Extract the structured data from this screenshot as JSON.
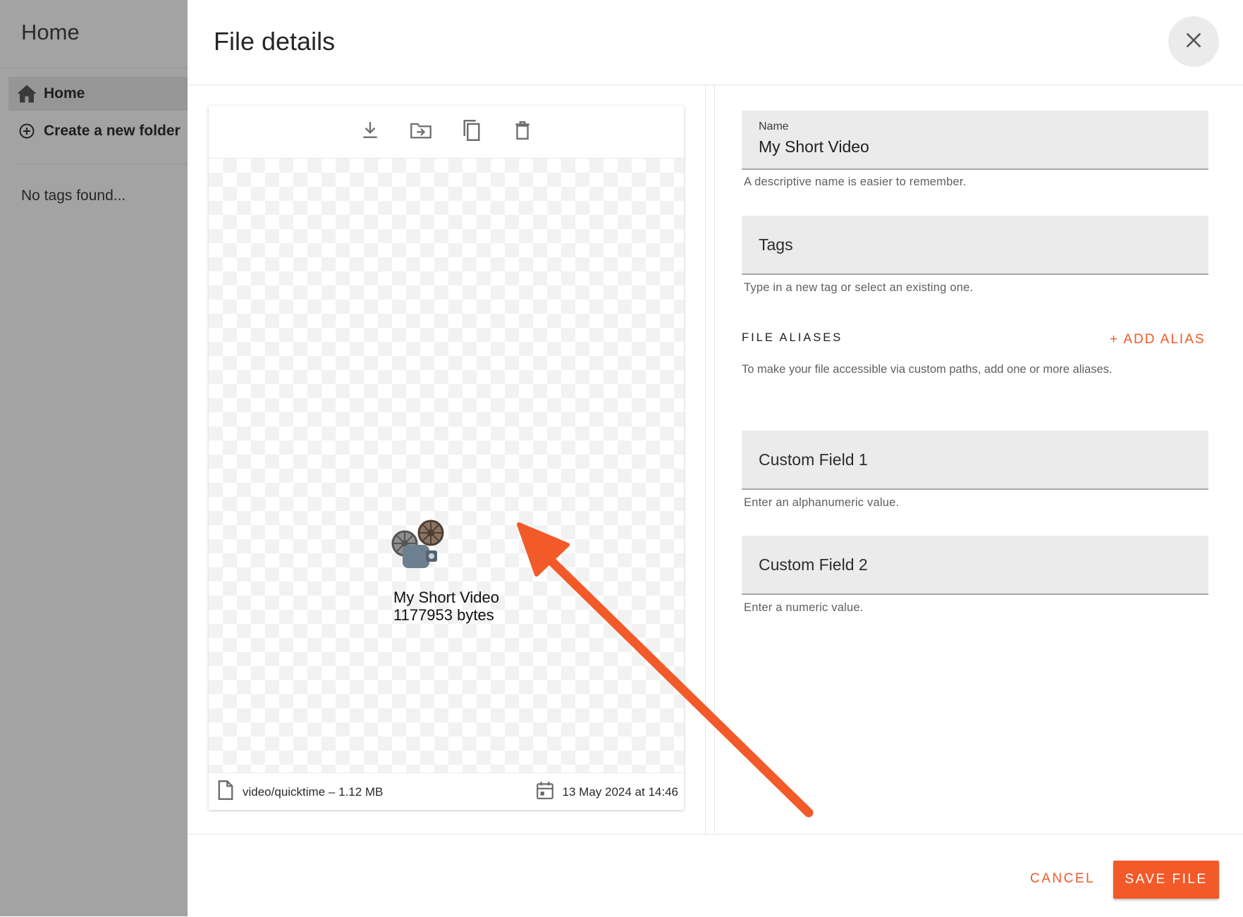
{
  "sidebar": {
    "title": "Home",
    "items": [
      {
        "label": "Home",
        "icon": "home-icon",
        "active": true
      },
      {
        "label": "Create a new folder",
        "icon": "add-circle-icon",
        "active": false
      }
    ],
    "tags_empty": "No tags found..."
  },
  "dialog": {
    "title": "File details",
    "toolbar": [
      "download-icon",
      "move-to-folder-icon",
      "copy-icon",
      "delete-icon"
    ],
    "preview": {
      "name": "My Short Video",
      "size": "1177953 bytes",
      "icon": "film-projector-icon"
    },
    "meta": {
      "type_size": "video/quicktime – 1.12 MB",
      "date": "13 May 2024 at 14:46"
    },
    "form": {
      "name_label": "Name",
      "name_value": "My Short Video",
      "name_hint": "A descriptive name is easier to remember.",
      "tags_placeholder": "Tags",
      "tags_hint": "Type in a new tag or select an existing one.",
      "aliases_title": "FILE ALIASES",
      "add_alias": "+ ADD ALIAS",
      "aliases_hint": "To make your file accessible via custom paths, add one or more aliases.",
      "custom1_label": "Custom Field 1",
      "custom1_hint": "Enter an alphanumeric value.",
      "custom2_label": "Custom Field 2",
      "custom2_hint": "Enter a numeric value."
    },
    "actions": {
      "cancel": "CANCEL",
      "save": "SAVE FILE"
    }
  },
  "colors": {
    "accent": "#f25a29",
    "overlay": "#a3a3a3",
    "field_bg": "#ebebeb"
  }
}
